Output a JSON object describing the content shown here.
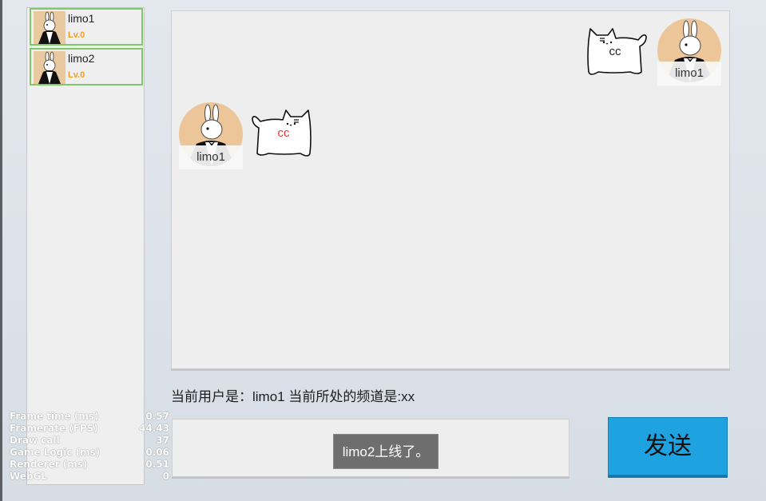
{
  "users": [
    {
      "name": "limo1",
      "level": "Lv.0"
    },
    {
      "name": "limo2",
      "level": "Lv.0"
    }
  ],
  "messages": [
    {
      "sender": "limo1",
      "text": "cc",
      "text_color": "#222222",
      "side": "right"
    },
    {
      "sender": "limo1",
      "text": "cc",
      "text_color": "#e53935",
      "side": "left"
    }
  ],
  "status": {
    "text": "当前用户是：limo1  当前所处的频道是:xx"
  },
  "input": {
    "toast": "limo2上线了。"
  },
  "send_button": {
    "label": "发送"
  },
  "stats": [
    {
      "label": "Frame time (ms)",
      "value": "0.57"
    },
    {
      "label": "Framerate (FPS)",
      "value": "44.43"
    },
    {
      "label": "Draw call",
      "value": "37"
    },
    {
      "label": "Game Logic (ms)",
      "value": "0.06"
    },
    {
      "label": "Renderer (ms)",
      "value": "0.51"
    },
    {
      "label": "WebGL",
      "value": "0"
    }
  ],
  "colors": {
    "accent": "#1ea3e0",
    "user_border": "#7fc96a",
    "level": "#f0a020",
    "avatar_bg": "#ecc699"
  },
  "icons": {
    "avatar": "rabbit-avatar-icon",
    "bubble": "cat-bubble-icon"
  }
}
